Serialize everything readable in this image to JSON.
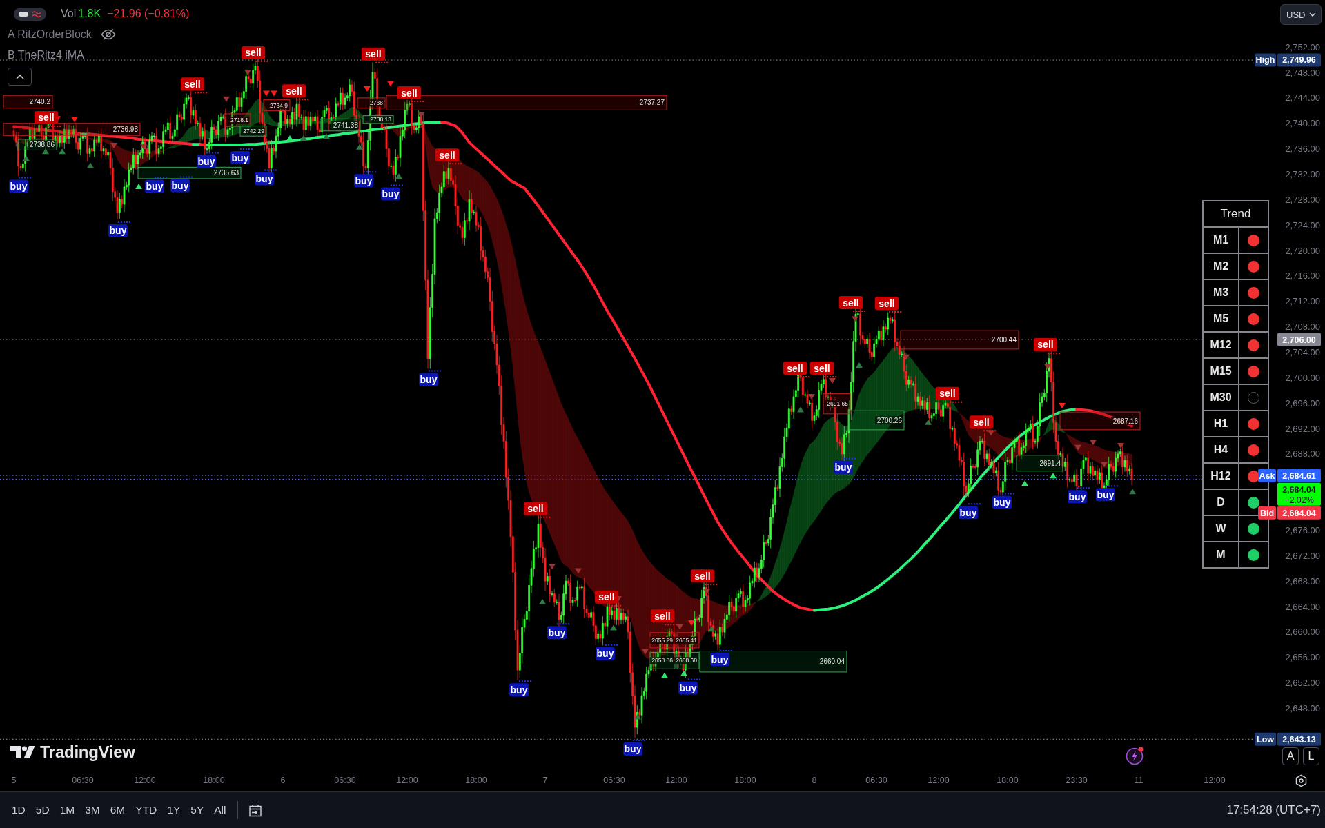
{
  "legend": {
    "volume_label": "Vol",
    "volume": "1.8K",
    "change": "−21.96 (−0.81%)",
    "indicators": [
      {
        "label": "A RitzOrderBlock",
        "hidden": true
      },
      {
        "label": "B TheRitz4 iMA",
        "hidden": false
      }
    ]
  },
  "currency_button": {
    "label": "USD"
  },
  "chart": {
    "price_axis": [
      "2,752.00",
      "2,748.00",
      "2,744.00",
      "2,740.00",
      "2,736.00",
      "2,732.00",
      "2,728.00",
      "2,724.00",
      "2,720.00",
      "2,716.00",
      "2,712.00",
      "2,708.00",
      "2,704.00",
      "2,700.00",
      "2,696.00",
      "2,692.00",
      "2,688.00",
      "2,676.00",
      "2,672.00",
      "2,668.00",
      "2,664.00",
      "2,660.00",
      "2,656.00",
      "2,652.00",
      "2,648.00"
    ],
    "time_axis": [
      "5",
      "06:30",
      "12:00",
      "18:00",
      "6",
      "06:30",
      "12:00",
      "18:00",
      "7",
      "06:30",
      "12:00",
      "18:00",
      "8",
      "06:30",
      "12:00",
      "18:00",
      "23:30",
      "11",
      "12:00"
    ],
    "order_blocks": [
      {
        "kind": "supply",
        "text": "2740.2"
      },
      {
        "kind": "supply",
        "text": "2734.9"
      },
      {
        "kind": "supply",
        "text": "2738"
      },
      {
        "kind": "supply",
        "text": "2737.27"
      },
      {
        "kind": "supply",
        "text": "2718.1"
      },
      {
        "kind": "demand",
        "text": "2738.13"
      },
      {
        "kind": "demand",
        "text": "2741.38"
      },
      {
        "kind": "supply",
        "text": "2736.98"
      },
      {
        "kind": "demand",
        "text": "2742.29"
      },
      {
        "kind": "demand",
        "text": "2738.86"
      },
      {
        "kind": "demand",
        "text": "2735.63"
      },
      {
        "kind": "supply",
        "text": "2700.44"
      },
      {
        "kind": "supply",
        "text": "2691.65"
      },
      {
        "kind": "demand",
        "text": "2700.26"
      },
      {
        "kind": "supply",
        "text": "2687.16"
      },
      {
        "kind": "demand",
        "text": "2691.4"
      },
      {
        "kind": "supply",
        "text": "2655.29"
      },
      {
        "kind": "supply",
        "text": "2655.41"
      },
      {
        "kind": "demand",
        "text": "2658.86"
      },
      {
        "kind": "demand",
        "text": "2658.68"
      },
      {
        "kind": "demand",
        "text": "2660.04"
      }
    ],
    "signals": [
      {
        "kind": "buy",
        "text": "buy"
      },
      {
        "kind": "sell",
        "text": "sell"
      },
      {
        "kind": "buy",
        "text": "buy"
      },
      {
        "kind": "buy",
        "text": "buy"
      },
      {
        "kind": "buy",
        "text": "buy"
      },
      {
        "kind": "sell",
        "text": "sell"
      },
      {
        "kind": "buy",
        "text": "buy"
      },
      {
        "kind": "buy",
        "text": "buy"
      },
      {
        "kind": "sell",
        "text": "sell"
      },
      {
        "kind": "buy",
        "text": "buy"
      },
      {
        "kind": "sell",
        "text": "sell"
      },
      {
        "kind": "buy",
        "text": "buy"
      },
      {
        "kind": "sell",
        "text": "sell"
      },
      {
        "kind": "buy",
        "text": "buy"
      },
      {
        "kind": "sell",
        "text": "sell"
      },
      {
        "kind": "buy",
        "text": "buy"
      },
      {
        "kind": "sell",
        "text": "sell"
      },
      {
        "kind": "buy",
        "text": "buy"
      },
      {
        "kind": "sell",
        "text": "sell"
      },
      {
        "kind": "buy",
        "text": "buy"
      },
      {
        "kind": "buy",
        "text": "buy"
      },
      {
        "kind": "sell",
        "text": "sell"
      },
      {
        "kind": "buy",
        "text": "buy"
      },
      {
        "kind": "sell",
        "text": "sell"
      },
      {
        "kind": "buy",
        "text": "buy"
      },
      {
        "kind": "sell",
        "text": "sell"
      },
      {
        "kind": "buy",
        "text": "buy"
      },
      {
        "kind": "sell",
        "text": "sell"
      },
      {
        "kind": "sell",
        "text": "sell"
      },
      {
        "kind": "buy",
        "text": "buy"
      },
      {
        "kind": "sell",
        "text": "sell"
      },
      {
        "kind": "sell",
        "text": "sell"
      },
      {
        "kind": "sell",
        "text": "sell"
      },
      {
        "kind": "buy",
        "text": "buy"
      },
      {
        "kind": "sell",
        "text": "sell"
      },
      {
        "kind": "buy",
        "text": "buy"
      },
      {
        "kind": "sell",
        "text": "sell"
      },
      {
        "kind": "buy",
        "text": "buy"
      },
      {
        "kind": "buy",
        "text": "buy"
      }
    ],
    "price_tags": [
      {
        "kind": "extreme",
        "label": "High",
        "text": "2,749.96",
        "color": "#1e3a6e"
      },
      {
        "kind": "level",
        "text": "2,706.00",
        "color": "#868993"
      },
      {
        "kind": "quote",
        "label": "Ask",
        "text": "2,684.61",
        "color": "#2962ff"
      },
      {
        "kind": "last",
        "text": "2,684.04",
        "subtext": "−2.02%",
        "color": "#00ff00"
      },
      {
        "kind": "quote",
        "label": "Bid",
        "text": "2,684.04",
        "color": "#f23645"
      },
      {
        "kind": "extreme",
        "label": "Low",
        "text": "2,643.13",
        "color": "#1e3a6e"
      }
    ]
  },
  "trend_table": {
    "title": "Trend",
    "rows": [
      {
        "label": "M1",
        "filled": true,
        "color": "#f23232"
      },
      {
        "label": "M2",
        "filled": true,
        "color": "#f23232"
      },
      {
        "label": "M3",
        "filled": true,
        "color": "#f23232"
      },
      {
        "label": "M5",
        "filled": true,
        "color": "#f23232"
      },
      {
        "label": "M12",
        "filled": true,
        "color": "#f23232"
      },
      {
        "label": "M15",
        "filled": true,
        "color": "#f23232"
      },
      {
        "label": "M30",
        "filled": false
      },
      {
        "label": "H1",
        "filled": true,
        "color": "#f23232"
      },
      {
        "label": "H4",
        "filled": true,
        "color": "#f23232"
      },
      {
        "label": "H12",
        "filled": true,
        "color": "#f23232"
      },
      {
        "label": "D",
        "filled": true,
        "color": "#1fce66"
      },
      {
        "label": "W",
        "filled": true,
        "color": "#1fce66"
      },
      {
        "label": "M",
        "filled": true,
        "color": "#1fce66"
      }
    ]
  },
  "scale_buttons": [
    {
      "label": "A",
      "selected": false
    },
    {
      "label": "L",
      "selected": false
    }
  ],
  "logo": {
    "name": "TradingView"
  },
  "toolbar": {
    "ranges": [
      {
        "label": "1D",
        "selected": false
      },
      {
        "label": "5D",
        "selected": false
      },
      {
        "label": "1M",
        "selected": false
      },
      {
        "label": "3M",
        "selected": false
      },
      {
        "label": "6M",
        "selected": false
      },
      {
        "label": "YTD",
        "selected": false
      },
      {
        "label": "1Y",
        "selected": false
      },
      {
        "label": "5Y",
        "selected": false
      },
      {
        "label": "All",
        "selected": false
      }
    ],
    "clock": "17:54:28 (UTC+7)"
  }
}
